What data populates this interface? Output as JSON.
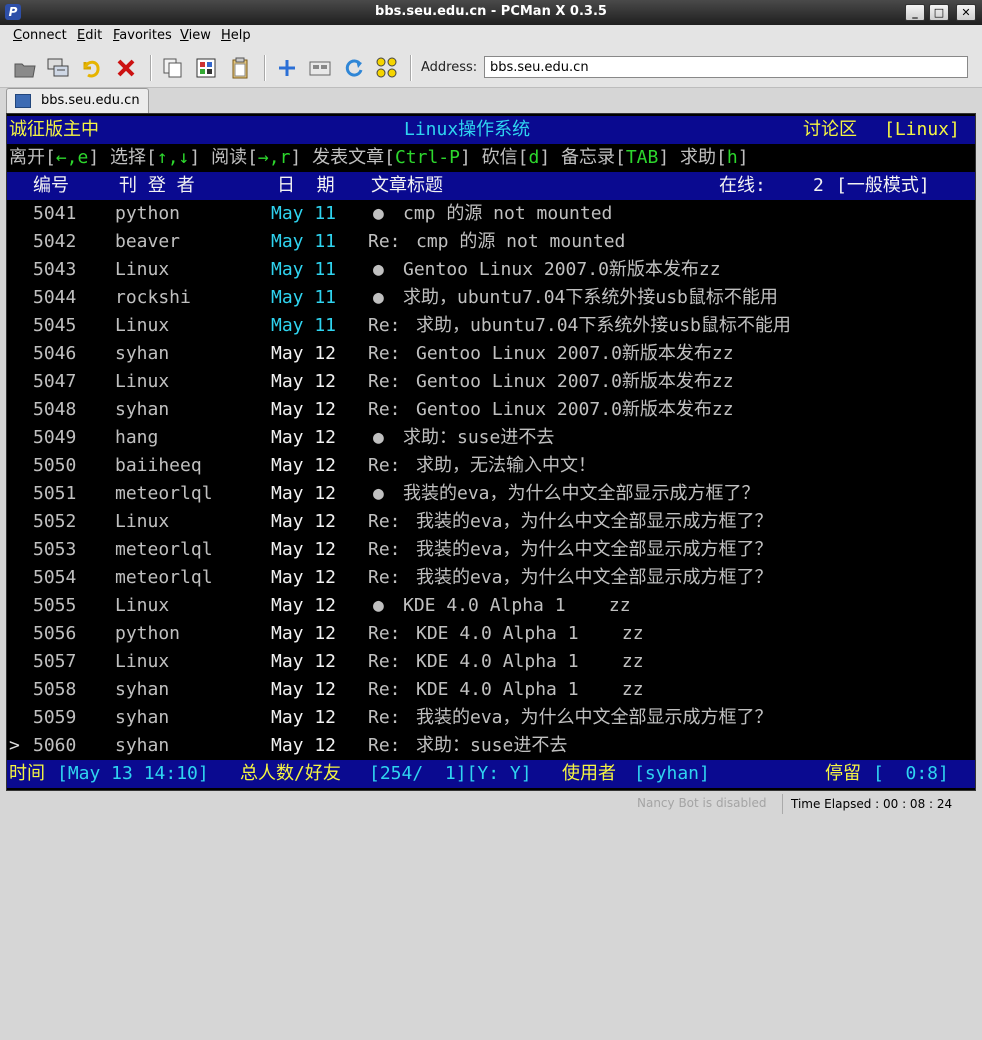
{
  "window": {
    "title": "bbs.seu.edu.cn - PCMan X 0.3.5",
    "icon_letter": "P",
    "min_glyph": "_",
    "max_glyph": "□",
    "close_glyph": "✕"
  },
  "menu": [
    {
      "accel": "C",
      "rest": "onnect"
    },
    {
      "accel": "E",
      "rest": "dit"
    },
    {
      "accel": "F",
      "rest": "avorites"
    },
    {
      "accel": "V",
      "rest": "iew"
    },
    {
      "accel": "H",
      "rest": "elp"
    }
  ],
  "toolbar": {
    "icons": [
      "folder-icon",
      "sites-icon",
      "reconnect-icon",
      "disconnect-icon",
      "copy-icon",
      "paste-colored-icon",
      "clipboard-icon",
      "add-favorite-icon",
      "emoticon-icon",
      "refresh-icon",
      "nav-grid-icon"
    ],
    "address_label": "Address:",
    "address_value": "bbs.seu.edu.cn"
  },
  "tab": {
    "label": "bbs.seu.edu.cn"
  },
  "board": {
    "header_left": "诚征版主中",
    "header_center": "Linux操作系统",
    "header_right_label": "讨论区",
    "header_right_board": "[Linux]",
    "help_line": [
      {
        "text": "离开[",
        "color": "gray"
      },
      {
        "text": "←,e",
        "color": "green"
      },
      {
        "text": "] 选择[",
        "color": "gray"
      },
      {
        "text": "↑,↓",
        "color": "green"
      },
      {
        "text": "] 阅读[",
        "color": "gray"
      },
      {
        "text": "→,r",
        "color": "green"
      },
      {
        "text": "] 发表文章[",
        "color": "gray"
      },
      {
        "text": "Ctrl-P",
        "color": "green"
      },
      {
        "text": "] 砍信[",
        "color": "gray"
      },
      {
        "text": "d",
        "color": "green"
      },
      {
        "text": "] 备忘录[",
        "color": "gray"
      },
      {
        "text": "TAB",
        "color": "green"
      },
      {
        "text": "] 求助[",
        "color": "gray"
      },
      {
        "text": "h",
        "color": "green"
      },
      {
        "text": "]",
        "color": "gray"
      }
    ],
    "col_headers": {
      "num": "编号",
      "author": "刊 登 者",
      "date": "日  期",
      "title": "文章标题",
      "online": "在线:",
      "online_count": "2",
      "mode": "[一般模式]"
    },
    "posts": [
      {
        "num": "5041",
        "author": "python",
        "date": "May 11",
        "date_color": "cyan",
        "prefix": "●",
        "title": "cmp 的源 not mounted"
      },
      {
        "num": "5042",
        "author": "beaver",
        "date": "May 11",
        "date_color": "cyan",
        "prefix": "Re:",
        "title": "cmp 的源 not mounted"
      },
      {
        "num": "5043",
        "author": "Linux",
        "date": "May 11",
        "date_color": "cyan",
        "prefix": "●",
        "title": "Gentoo Linux 2007.0新版本发布zz"
      },
      {
        "num": "5044",
        "author": "rockshi",
        "date": "May 11",
        "date_color": "cyan",
        "prefix": "●",
        "title": "求助，ubuntu7.04下系统外接usb鼠标不能用"
      },
      {
        "num": "5045",
        "author": "Linux",
        "date": "May 11",
        "date_color": "cyan",
        "prefix": "Re:",
        "title": "求助，ubuntu7.04下系统外接usb鼠标不能用"
      },
      {
        "num": "5046",
        "author": "syhan",
        "date": "May 12",
        "date_color": "white",
        "prefix": "Re:",
        "title": "Gentoo Linux 2007.0新版本发布zz"
      },
      {
        "num": "5047",
        "author": "Linux",
        "date": "May 12",
        "date_color": "white",
        "prefix": "Re:",
        "title": "Gentoo Linux 2007.0新版本发布zz"
      },
      {
        "num": "5048",
        "author": "syhan",
        "date": "May 12",
        "date_color": "white",
        "prefix": "Re:",
        "title": "Gentoo Linux 2007.0新版本发布zz"
      },
      {
        "num": "5049",
        "author": "hang",
        "date": "May 12",
        "date_color": "white",
        "prefix": "●",
        "title": "求助：suse进不去"
      },
      {
        "num": "5050",
        "author": "baiiheeq",
        "date": "May 12",
        "date_color": "white",
        "prefix": "Re:",
        "title": "求助，无法输入中文！"
      },
      {
        "num": "5051",
        "author": "meteorlql",
        "date": "May 12",
        "date_color": "white",
        "prefix": "●",
        "title": "我装的eva，为什么中文全部显示成方框了？"
      },
      {
        "num": "5052",
        "author": "Linux",
        "date": "May 12",
        "date_color": "white",
        "prefix": "Re:",
        "title": "我装的eva，为什么中文全部显示成方框了？"
      },
      {
        "num": "5053",
        "author": "meteorlql",
        "date": "May 12",
        "date_color": "white",
        "prefix": "Re:",
        "title": "我装的eva，为什么中文全部显示成方框了？"
      },
      {
        "num": "5054",
        "author": "meteorlql",
        "date": "May 12",
        "date_color": "white",
        "prefix": "Re:",
        "title": "我装的eva，为什么中文全部显示成方框了？"
      },
      {
        "num": "5055",
        "author": "Linux",
        "date": "May 12",
        "date_color": "white",
        "prefix": "●",
        "title": "KDE 4.0 Alpha 1    zz"
      },
      {
        "num": "5056",
        "author": "python",
        "date": "May 12",
        "date_color": "white",
        "prefix": "Re:",
        "title": "KDE 4.0 Alpha 1    zz"
      },
      {
        "num": "5057",
        "author": "Linux",
        "date": "May 12",
        "date_color": "white",
        "prefix": "Re:",
        "title": "KDE 4.0 Alpha 1    zz"
      },
      {
        "num": "5058",
        "author": "syhan",
        "date": "May 12",
        "date_color": "white",
        "prefix": "Re:",
        "title": "KDE 4.0 Alpha 1    zz"
      },
      {
        "num": "5059",
        "author": "syhan",
        "date": "May 12",
        "date_color": "white",
        "prefix": "Re:",
        "title": "我装的eva，为什么中文全部显示成方框了？"
      },
      {
        "num": "5060",
        "author": "syhan",
        "date": "May 12",
        "date_color": "white",
        "prefix": "Re:",
        "title": "求助：suse进不去",
        "cursor": ">"
      }
    ],
    "footer": {
      "time_label": "时间",
      "time_value": "[May 13 14:10]",
      "users_label": "总人数/好友",
      "users_value": "[254/  1][Y: Y]",
      "user_label": "使用者",
      "user_value": "[syhan]",
      "stay_label": "停留",
      "stay_value": "[  0:8]"
    }
  },
  "status": {
    "bot": "Nancy Bot is disabled",
    "elapsed": "Time Elapsed : 00 : 08 : 24"
  },
  "colors": {
    "terminal_bg": "#000000",
    "bar_blue": "#0a0a90",
    "yellow": "#f5f542",
    "green": "#2dd72d",
    "cyan": "#2fd4f0",
    "text_gray": "#c0c0c0"
  }
}
